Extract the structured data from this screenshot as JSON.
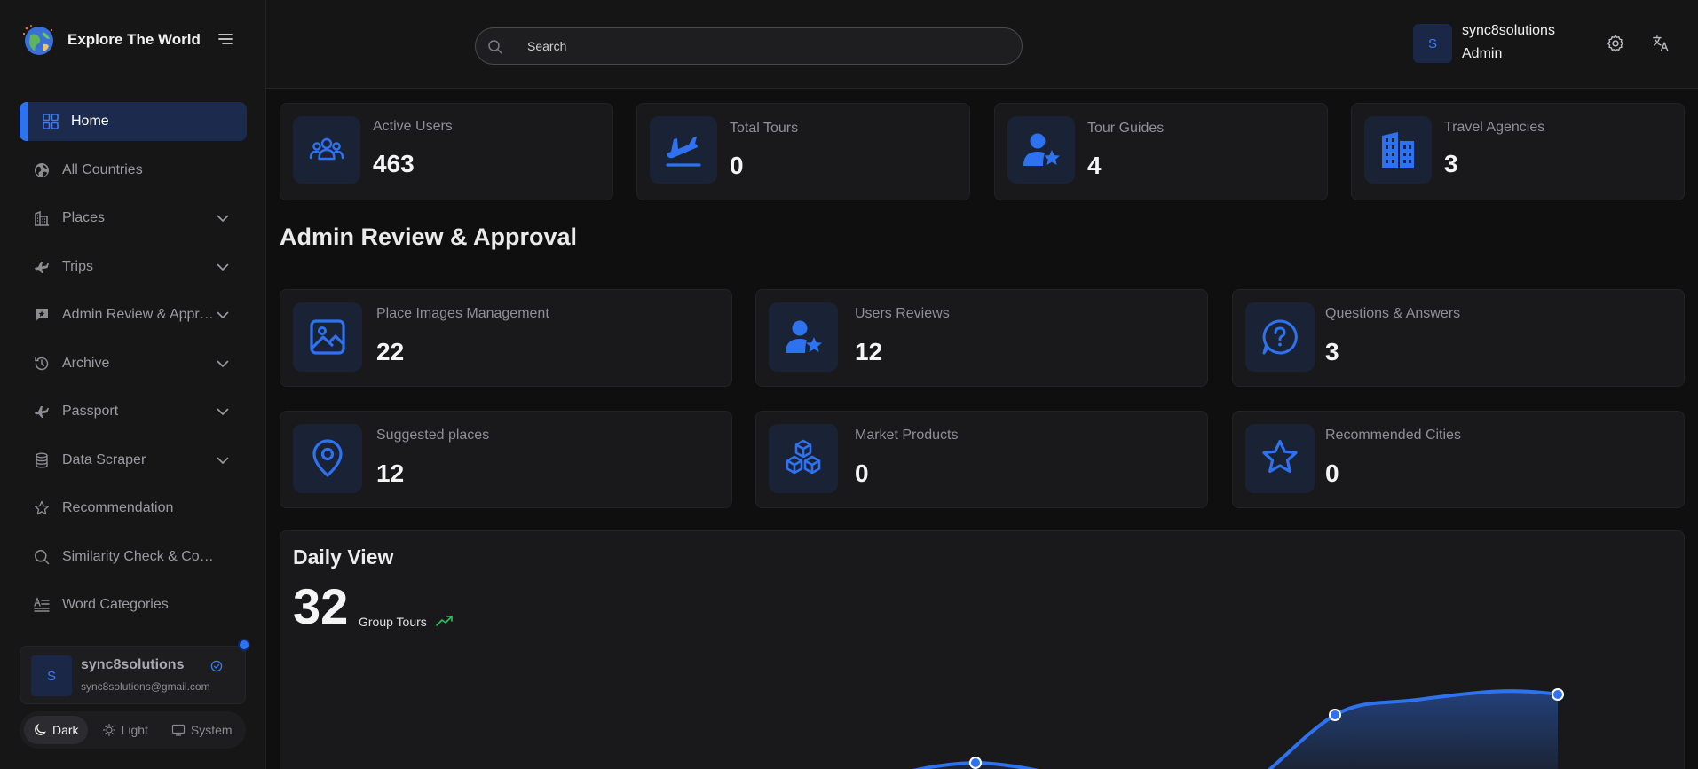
{
  "app": {
    "name": "Explore The World"
  },
  "sidebar": {
    "items": [
      {
        "label": "Home",
        "icon": "grid-icon",
        "active": true,
        "expandable": false
      },
      {
        "label": "All Countries",
        "icon": "globe-icon",
        "expandable": false
      },
      {
        "label": "Places",
        "icon": "buildings-icon",
        "expandable": true
      },
      {
        "label": "Trips",
        "icon": "plane-icon",
        "expandable": true
      },
      {
        "label": "Admin Review & Approval",
        "icon": "review-star-icon",
        "expandable": true
      },
      {
        "label": "Archive",
        "icon": "history-icon",
        "expandable": true
      },
      {
        "label": "Passport",
        "icon": "plane-icon",
        "expandable": true
      },
      {
        "label": "Data Scraper",
        "icon": "database-icon",
        "expandable": true
      },
      {
        "label": "Recommendation",
        "icon": "star-outline-icon",
        "expandable": false
      },
      {
        "label": "Similarity Check & Coordinates",
        "icon": "search-icon",
        "expandable": false
      },
      {
        "label": "Word Categories",
        "icon": "text-lines-icon",
        "expandable": false
      }
    ],
    "user": {
      "avatar_letter": "S",
      "name": "sync8solutions",
      "email": "sync8solutions@gmail.com"
    },
    "theme": {
      "dark": "Dark",
      "light": "Light",
      "system": "System",
      "selected": "Dark"
    }
  },
  "header": {
    "search_placeholder": "Search",
    "user": {
      "avatar_letter": "S",
      "name": "sync8solutions",
      "role": "Admin"
    }
  },
  "stats": [
    {
      "title": "Active Users",
      "value": "463",
      "icon": "users-group-icon"
    },
    {
      "title": "Total Tours",
      "value": "0",
      "icon": "plane-departure-icon"
    },
    {
      "title": "Tour Guides",
      "value": "4",
      "icon": "user-star-icon"
    },
    {
      "title": "Travel Agencies",
      "value": "3",
      "icon": "building-icon"
    }
  ],
  "review_section": {
    "title": "Admin Review & Approval",
    "cards": [
      {
        "title": "Place Images Management",
        "value": "22",
        "icon": "image-icon"
      },
      {
        "title": "Users Reviews",
        "value": "12",
        "icon": "user-star-icon"
      },
      {
        "title": "Questions & Answers",
        "value": "3",
        "icon": "question-bubble-icon"
      },
      {
        "title": "Suggested places",
        "value": "12",
        "icon": "map-pin-icon"
      },
      {
        "title": "Market Products",
        "value": "0",
        "icon": "cubes-icon"
      },
      {
        "title": "Recommended Cities",
        "value": "0",
        "icon": "star-outline-icon"
      }
    ]
  },
  "daily_view": {
    "title": "Daily View",
    "value": "32",
    "label": "Group Tours",
    "accent": "#2f72f0",
    "trend_color": "#22c55e"
  },
  "colors": {
    "accent": "#2f72f0",
    "background": "#0f0f10",
    "card": "#19191b"
  }
}
